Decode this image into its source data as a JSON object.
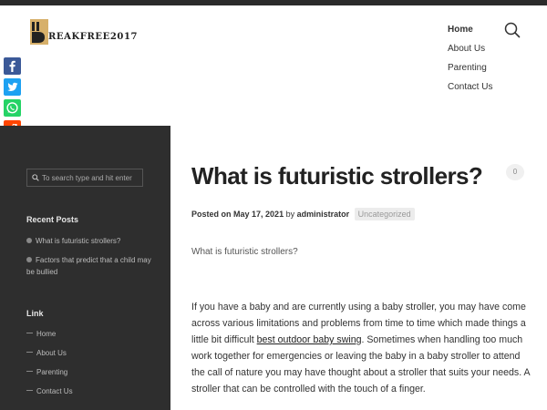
{
  "site": {
    "logo_letter": "B",
    "logo_text": "REAKFREE2017"
  },
  "nav": {
    "items": [
      "Home",
      "About Us",
      "Parenting",
      "Contact Us"
    ]
  },
  "share": [
    {
      "icon": "facebook-icon",
      "color": "#3b5998"
    },
    {
      "icon": "twitter-icon",
      "color": "#1da1f2"
    },
    {
      "icon": "whatsapp-icon",
      "color": "#25d366"
    },
    {
      "icon": "reddit-icon",
      "color": "#ff4500"
    },
    {
      "icon": "share-plus-icon",
      "color": "#0d6efd"
    }
  ],
  "sidebar": {
    "search_placeholder": "To search type and hit enter",
    "recent_posts_heading": "Recent Posts",
    "recent_posts": [
      "What is futuristic strollers?",
      "Factors that predict that a child may be bullied"
    ],
    "link_heading": "Link",
    "links": [
      "Home",
      "About Us",
      "Parenting",
      "Contact Us"
    ]
  },
  "post": {
    "title": "What is futuristic strollers?",
    "comment_count": "0",
    "posted_on_label": "Posted on",
    "date": "May 17, 2021",
    "by_label": "by",
    "author": "administrator",
    "category": "Uncategorized",
    "lead": "What is futuristic strollers?",
    "body_before_link": "If you have a baby and are currently using a baby stroller, you may have come across various limitations and problems from time to time which made things a little bit difficult ",
    "body_link": "best outdoor baby swing",
    "body_after_link": ". Sometimes when handling too much work together for emergencies or leaving the baby in a baby stroller to attend the call of nature you may have thought about a stroller that suits your needs. A stroller that can be controlled with the touch of a finger."
  }
}
